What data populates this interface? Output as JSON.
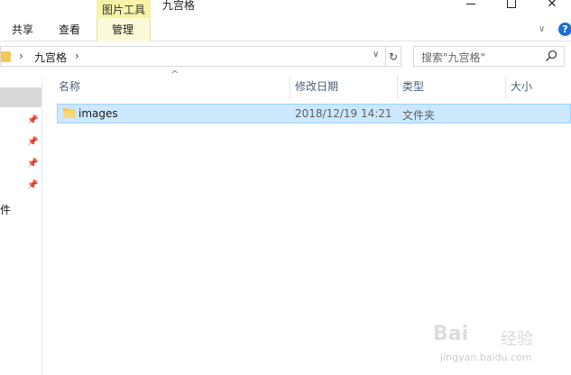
{
  "window": {
    "title": "九宫格",
    "context_tab": "图片工具"
  },
  "ribbon": {
    "tabs": [
      {
        "label": "共享"
      },
      {
        "label": "查看"
      },
      {
        "label": "管理"
      }
    ],
    "help_label": "?"
  },
  "address": {
    "path": "九宫格",
    "separator": "›"
  },
  "search": {
    "placeholder": "搜索\"九宫格\""
  },
  "columns": {
    "name": "名称",
    "date": "修改日期",
    "type": "类型",
    "size": "大小"
  },
  "files": [
    {
      "name": "images",
      "date": "2018/12/19 14:21",
      "type": "文件夹",
      "size": ""
    }
  ],
  "navpane": {
    "partial_label": "件"
  },
  "colors": {
    "selection_bg": "#cce8ff",
    "selection_border": "#99d1ff",
    "context_tab": "#f6f2a6",
    "folder": "#f5c85b",
    "help": "#1f6fd1"
  },
  "watermark": {
    "logo": "Bai",
    "brand": "经验",
    "url": "jingyan.baidu.com"
  }
}
